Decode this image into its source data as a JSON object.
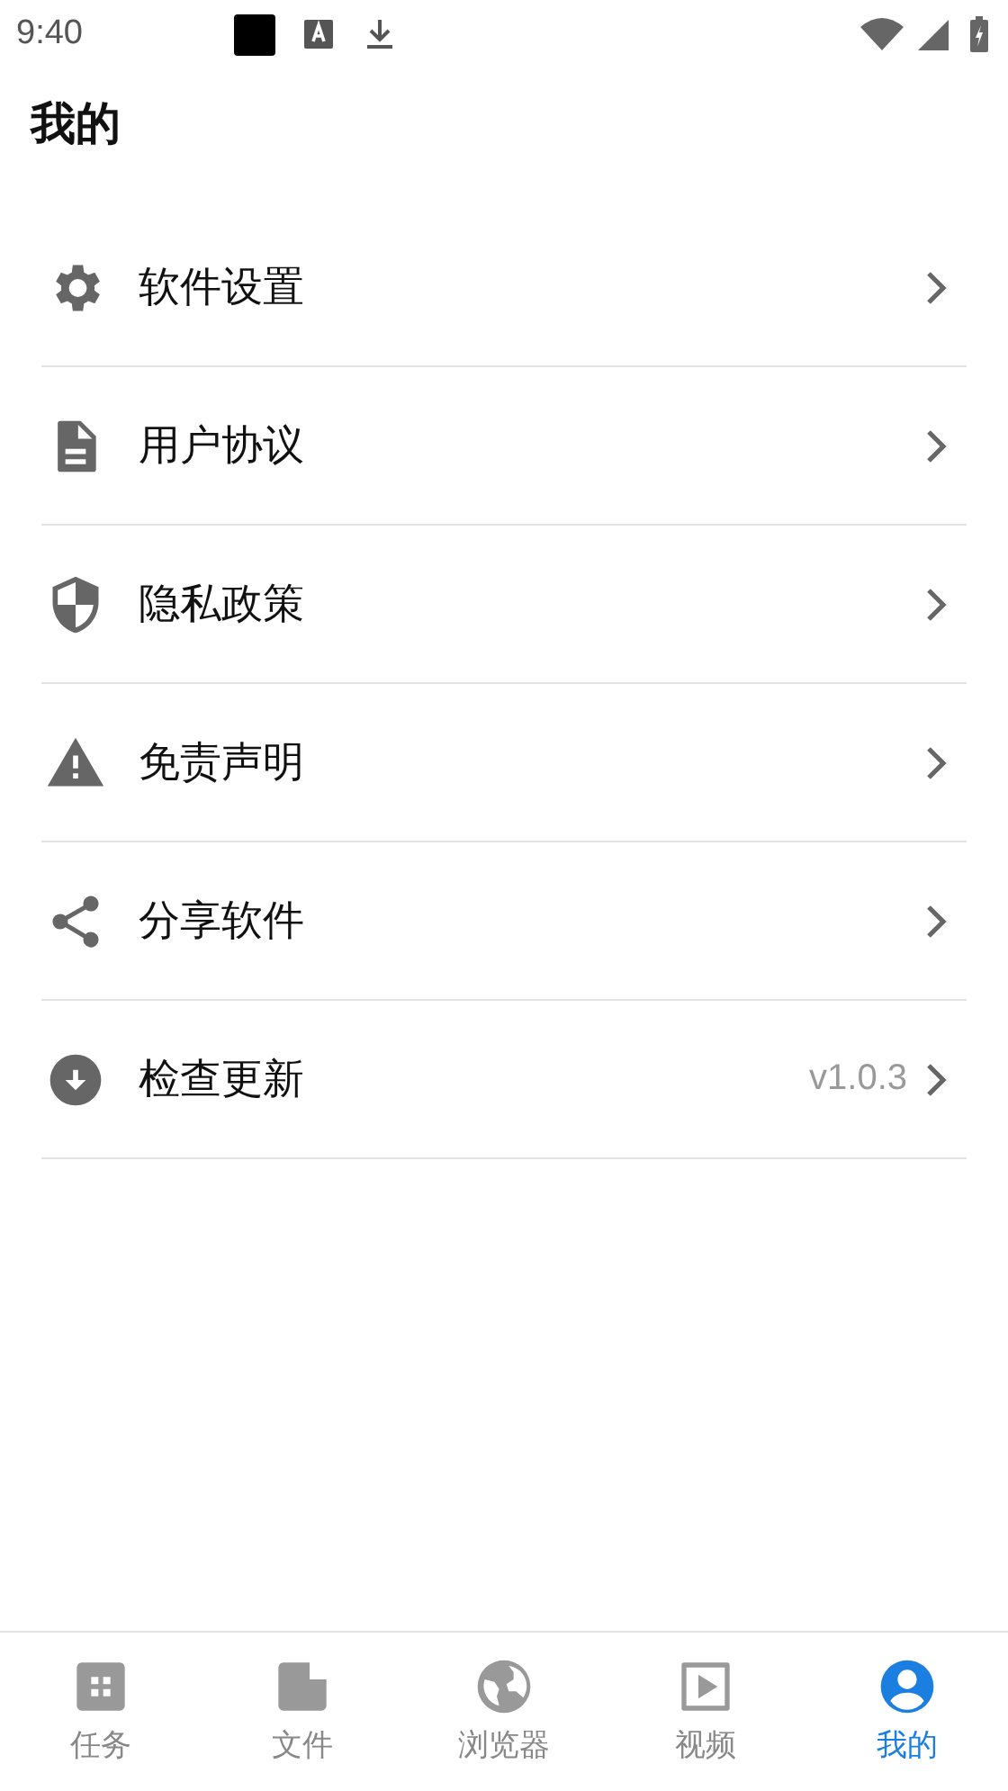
{
  "status_bar": {
    "time": "9:40"
  },
  "title": "我的",
  "menu": [
    {
      "kind": "gear",
      "label": "软件设置"
    },
    {
      "kind": "document",
      "label": "用户协议"
    },
    {
      "kind": "shield",
      "label": "隐私政策"
    },
    {
      "kind": "warning",
      "label": "免责声明"
    },
    {
      "kind": "share",
      "label": "分享软件"
    },
    {
      "kind": "download",
      "label": "检查更新",
      "value": "v1.0.3"
    }
  ],
  "bottom_nav": [
    {
      "kind": "grid",
      "label": "任务",
      "selected": false
    },
    {
      "kind": "file",
      "label": "文件",
      "selected": false
    },
    {
      "kind": "globe",
      "label": "浏览器",
      "selected": false
    },
    {
      "kind": "video",
      "label": "视频",
      "selected": false
    },
    {
      "kind": "person",
      "label": "我的",
      "selected": true
    }
  ]
}
